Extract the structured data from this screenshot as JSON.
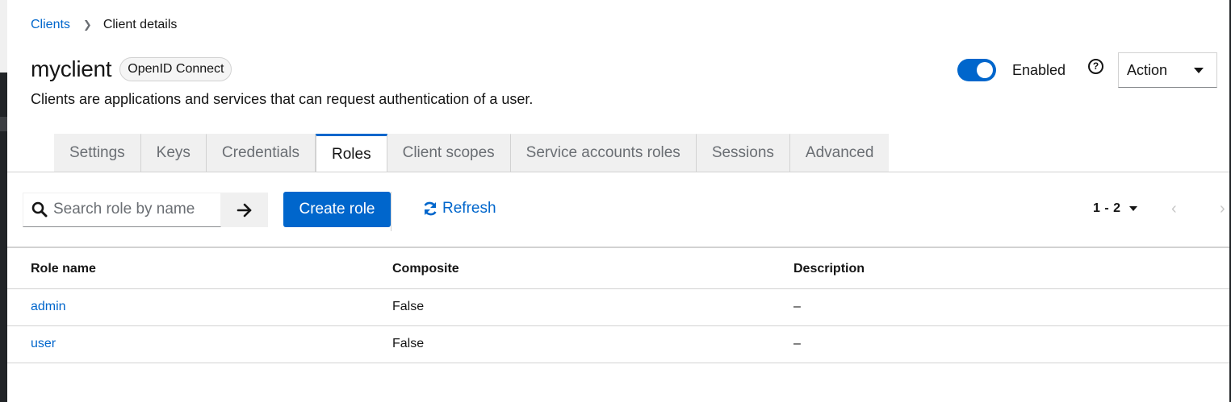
{
  "breadcrumb": {
    "parent": "Clients",
    "current": "Client details"
  },
  "header": {
    "title": "myclient",
    "protocol_badge": "OpenID Connect",
    "description": "Clients are applications and services that can request authentication of a user.",
    "enabled_label": "Enabled",
    "enabled": true,
    "help_icon": "question-circle-icon",
    "action_label": "Action"
  },
  "tabs": [
    {
      "label": "Settings",
      "active": false
    },
    {
      "label": "Keys",
      "active": false
    },
    {
      "label": "Credentials",
      "active": false
    },
    {
      "label": "Roles",
      "active": true
    },
    {
      "label": "Client scopes",
      "active": false
    },
    {
      "label": "Service accounts roles",
      "active": false
    },
    {
      "label": "Sessions",
      "active": false
    },
    {
      "label": "Advanced",
      "active": false
    }
  ],
  "toolbar": {
    "search_placeholder": "Search role by name",
    "create_label": "Create role",
    "refresh_label": "Refresh",
    "pagination_range": "1 - 2"
  },
  "table": {
    "columns": [
      "Role name",
      "Composite",
      "Description"
    ],
    "rows": [
      {
        "name": "admin",
        "composite": "False",
        "description": "–"
      },
      {
        "name": "user",
        "composite": "False",
        "description": "–"
      }
    ]
  },
  "colors": {
    "accent": "#0066cc",
    "tab_bg": "#f0f0f0"
  }
}
